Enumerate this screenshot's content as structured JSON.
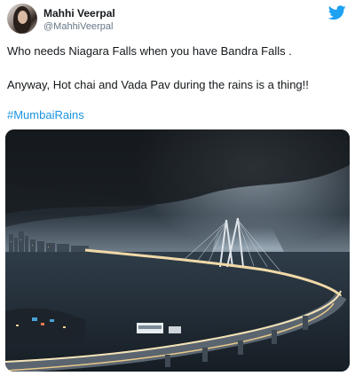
{
  "tweet": {
    "author_name": "Mahhi Veerpal",
    "author_handle": "@MahhiVeerpal",
    "lines": [
      "Who needs Niagara Falls when you have Bandra Falls .",
      "Anyway, Hot chai and Vada Pav during the rains is a thing!!"
    ],
    "hashtag": "#MumbaiRains",
    "icons": {
      "logo": "twitter-bird-icon"
    },
    "colors": {
      "brand": "#1da1f2",
      "link": "#1b95e0",
      "handle": "#657786"
    }
  }
}
